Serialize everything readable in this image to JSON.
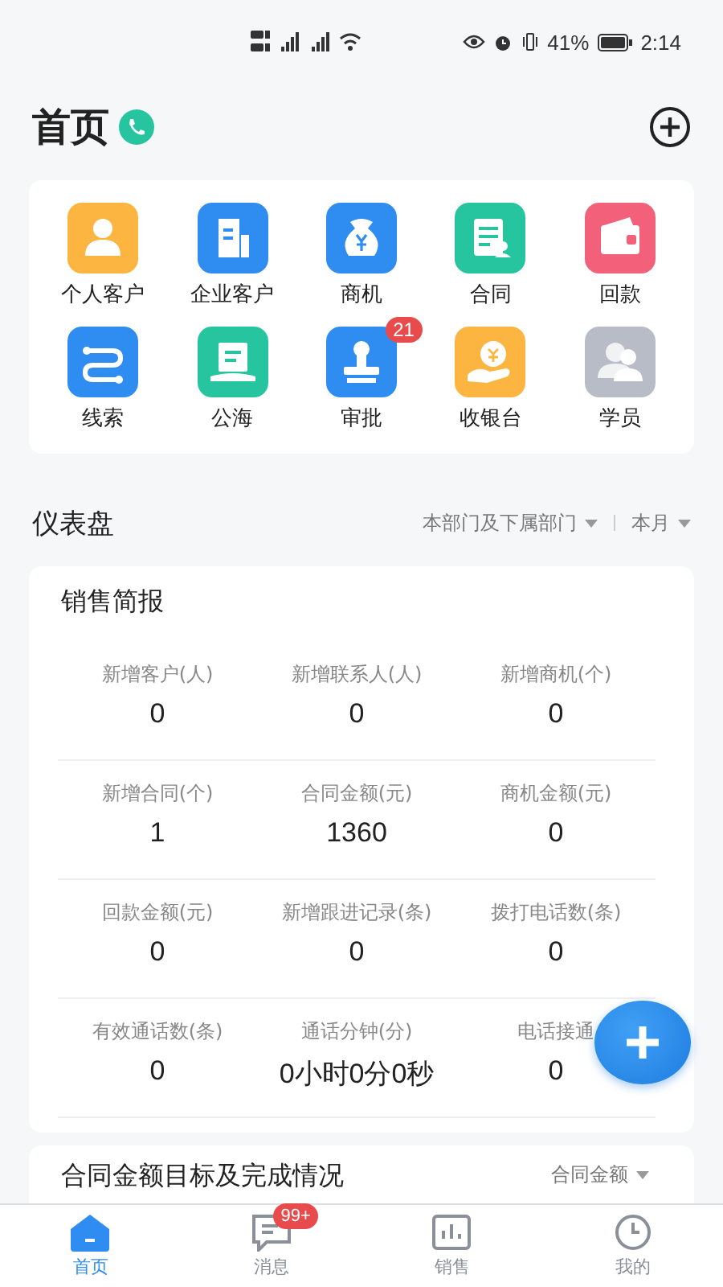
{
  "status_bar": {
    "battery": "41%",
    "time": "2:14"
  },
  "header": {
    "title": "首页"
  },
  "shortcuts": [
    {
      "label": "个人客户",
      "color": "#fbb540"
    },
    {
      "label": "企业客户",
      "color": "#2f8cf0"
    },
    {
      "label": "商机",
      "color": "#2f8cf0"
    },
    {
      "label": "合同",
      "color": "#27c4a0"
    },
    {
      "label": "回款",
      "color": "#f2607a"
    },
    {
      "label": "线索",
      "color": "#2f8cf0"
    },
    {
      "label": "公海",
      "color": "#27c4a0"
    },
    {
      "label": "审批",
      "color": "#2f8cf0",
      "badge": "21"
    },
    {
      "label": "收银台",
      "color": "#fbb540"
    },
    {
      "label": "学员",
      "color": "#b8bcc6"
    }
  ],
  "dashboard": {
    "title": "仪表盘",
    "filters": [
      "本部门及下属部门",
      "本月"
    ]
  },
  "sales_report": {
    "title": "销售简报",
    "stats": [
      {
        "label": "新增客户(人)",
        "value": "0"
      },
      {
        "label": "新增联系人(人)",
        "value": "0"
      },
      {
        "label": "新增商机(个)",
        "value": "0"
      },
      {
        "label": "新增合同(个)",
        "value": "1"
      },
      {
        "label": "合同金额(元)",
        "value": "1360"
      },
      {
        "label": "商机金额(元)",
        "value": "0"
      },
      {
        "label": "回款金额(元)",
        "value": "0"
      },
      {
        "label": "新增跟进记录(条)",
        "value": "0"
      },
      {
        "label": "拨打电话数(条)",
        "value": "0"
      },
      {
        "label": "有效通话数(条)",
        "value": "0"
      },
      {
        "label": "通话分钟(分)",
        "value": "0小时0分0秒"
      },
      {
        "label": "电话接通",
        "value": "0"
      }
    ]
  },
  "contract_card": {
    "title": "合同金额目标及完成情况",
    "filter": "合同金额"
  },
  "tab_bar": [
    {
      "label": "首页",
      "selected": true
    },
    {
      "label": "消息",
      "selected": false,
      "badge": "99+"
    },
    {
      "label": "销售",
      "selected": false
    },
    {
      "label": "我的",
      "selected": false
    }
  ]
}
